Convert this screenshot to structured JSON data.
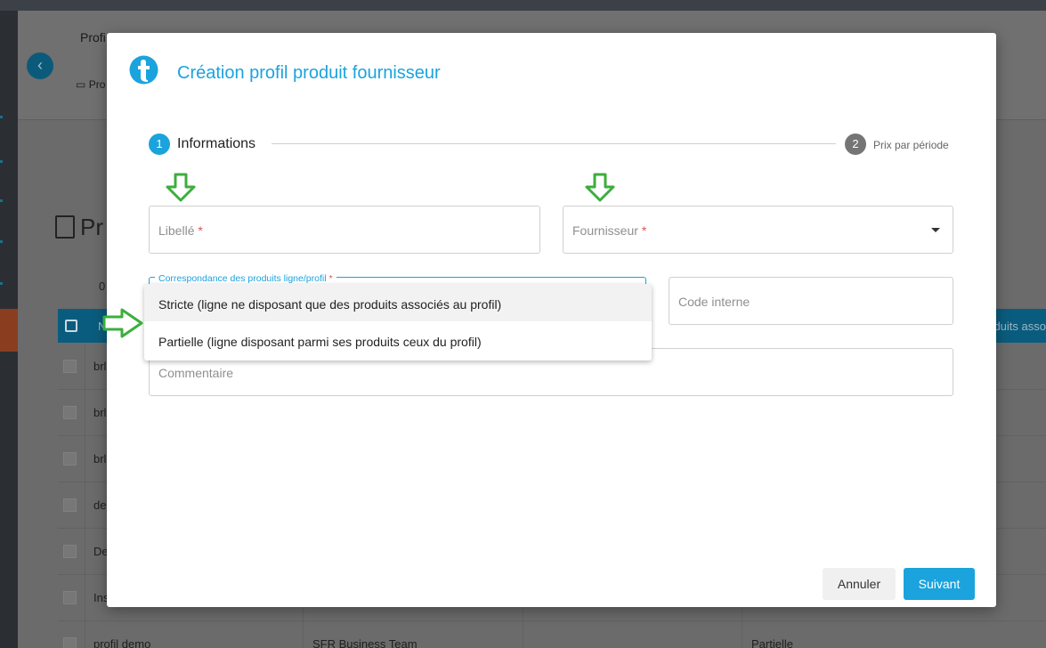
{
  "background": {
    "breadcrumb": "Profi",
    "sub_breadcrumb": "Pro",
    "page_title": "Pr",
    "count": "0",
    "table": {
      "header_name": "N",
      "header_partial": "duits asso",
      "rows": [
        {
          "c1": "brl",
          "c2": "",
          "c4": ""
        },
        {
          "c1": "brl",
          "c2": "",
          "c4": ""
        },
        {
          "c1": "brl",
          "c2": "",
          "c4": ""
        },
        {
          "c1": "de",
          "c2": "",
          "c4": ""
        },
        {
          "c1": "De",
          "c2": "",
          "c4": ""
        },
        {
          "c1": "Ins",
          "c2": "",
          "c4": ""
        },
        {
          "c1": "profil demo",
          "c2": "SFR Business Team",
          "c4": "Partielle"
        }
      ]
    }
  },
  "modal": {
    "title": "Création profil produit fournisseur",
    "stepper": {
      "steps": [
        {
          "number": "1",
          "label": "Informations"
        },
        {
          "number": "2",
          "label": "Prix par période"
        }
      ]
    },
    "fields": {
      "libelle": {
        "placeholder": "Libellé",
        "required_mark": "*"
      },
      "fournisseur": {
        "placeholder": "Fournisseur",
        "required_mark": "*"
      },
      "correspondance": {
        "label": "Correspondance des produits ligne/profil",
        "required_mark": "*"
      },
      "code_interne": {
        "placeholder": "Code interne"
      },
      "commentaire": {
        "placeholder": "Commentaire"
      }
    },
    "dropdown": {
      "options": [
        "Stricte (ligne ne disposant que des produits associés au profil)",
        "Partielle (ligne disposant parmi ses produits ceux du profil)"
      ]
    },
    "buttons": {
      "cancel": "Annuler",
      "next": "Suivant"
    }
  },
  "colors": {
    "accent": "#1ba3dd",
    "required": "#e05252",
    "annotation_arrow": "#3cae3c"
  }
}
